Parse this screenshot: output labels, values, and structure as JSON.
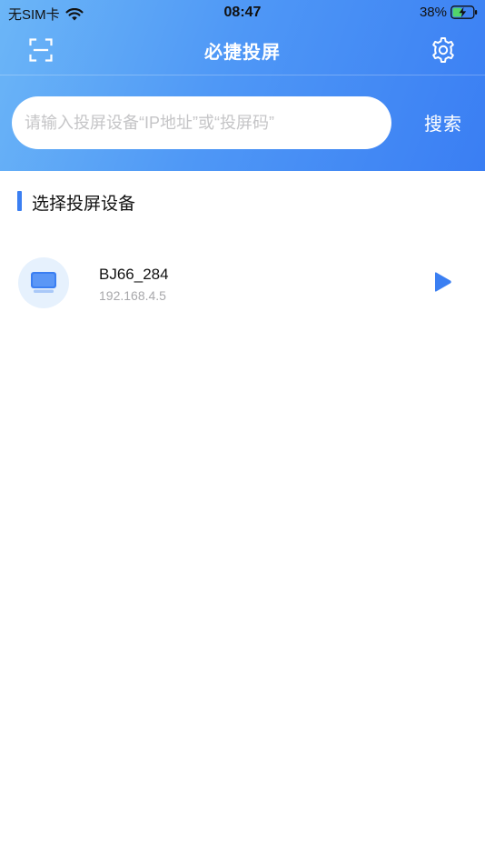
{
  "status_bar": {
    "carrier": "无SIM卡",
    "time": "08:47",
    "battery": "38%",
    "icons": [
      "wifi-icon",
      "battery-charging-icon"
    ]
  },
  "navbar": {
    "title": "必捷投屏",
    "left_icon": "scan-icon",
    "right_icon": "gear-icon"
  },
  "search": {
    "value": "",
    "placeholder": "请输入投屏设备“IP地址”或“投屏码”",
    "button_label": "搜索"
  },
  "section": {
    "title": "选择投屏设备"
  },
  "devices": [
    {
      "name": "BJ66_284",
      "ip": "192.168.4.5",
      "icon": "monitor-icon",
      "action_icon": "play-icon"
    }
  ],
  "colors": {
    "header_gradient_start": "#6cb6f7",
    "header_gradient_end": "#3a7ef3",
    "accent": "#3b7ff2",
    "avatar_bg": "#e6f1fd",
    "secondary_text": "#a8a8ab"
  }
}
